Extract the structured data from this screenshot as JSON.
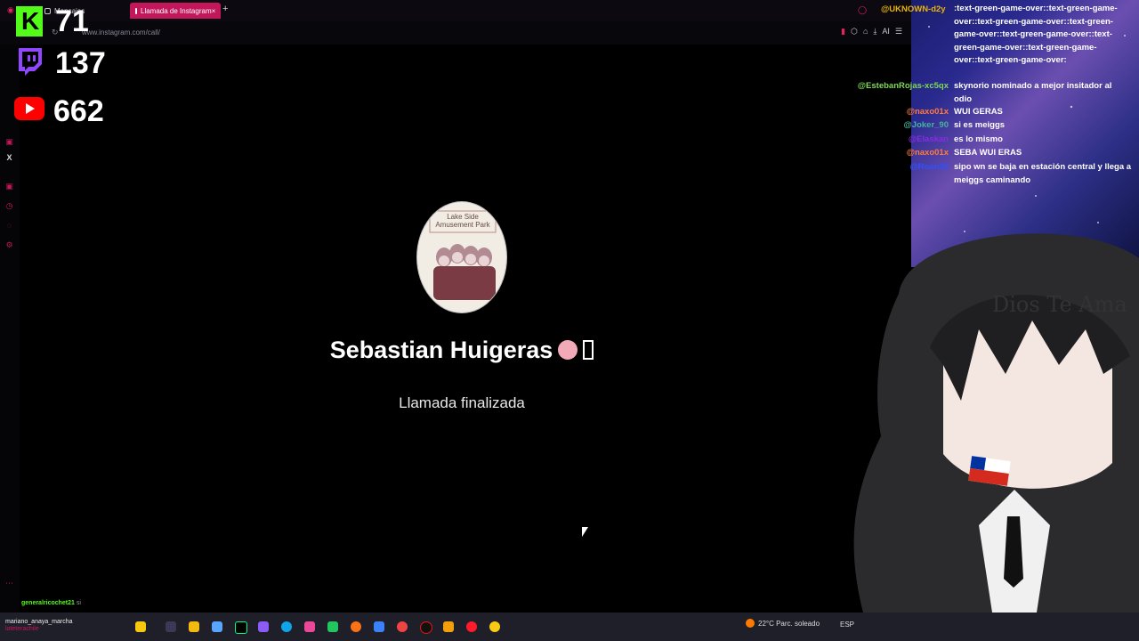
{
  "browser": {
    "tabs": [
      {
        "label": "Mensajes",
        "active": false
      },
      {
        "label": "Llamada de Instagram",
        "active": true
      }
    ],
    "new_tab": "+",
    "url": "www.instagram.com/call/",
    "ai_label": "AI"
  },
  "counters": {
    "kick": "71",
    "twitch": "137",
    "youtube": "662"
  },
  "call": {
    "avatar_sign_line1": "Lake Side",
    "avatar_sign_line2": "Amusement Park",
    "caller_name": "Sebastian Huigeras",
    "status": "Llamada finalizada"
  },
  "chat": {
    "top_user": "@UKNOWN-d2y",
    "messages": [
      {
        "user": "",
        "text": ":text-green-game-over::text-green-game-over::text-green-game-over::text-green-game-over::text-green-game-over::text-green-game-over::text-green-game-over::text-green-game-over:"
      },
      {
        "user": "@EstebanRojas-xc5qx",
        "text": "skynorio nominado a mejor insitador al odio",
        "color": "#7ed957"
      },
      {
        "user": "@naxo01x",
        "text": "WUI GERAS",
        "color": "#ff7a3d"
      },
      {
        "user": "@Joker_90",
        "text": "si es meiggs",
        "color": "#45b39d"
      },
      {
        "user": "@Elaskan",
        "text": "es lo mismo",
        "color": "#8a2be2"
      },
      {
        "user": "@naxo01x",
        "text": "SEBA WUI ERAS",
        "color": "#ff7a3d"
      },
      {
        "user": "@Roan35",
        "text": "sipo wn se baja en estación central y llega a meiggs caminando",
        "color": "#3050ff"
      }
    ]
  },
  "overlay": {
    "headband_text": "Dios Te Ama"
  },
  "bottom_chat": {
    "line1_user": "generalricochet21",
    "line1_text": "si",
    "line2": "mariano_anaya_marcha",
    "line3": "lateterachile"
  },
  "taskbar": {
    "weather": "22°C  Parc. soleado",
    "lang": "ESP"
  },
  "colors": {
    "kick_green": "#53fc18",
    "youtube_red": "#ff0000",
    "instagram_pink": "#c2185b"
  }
}
